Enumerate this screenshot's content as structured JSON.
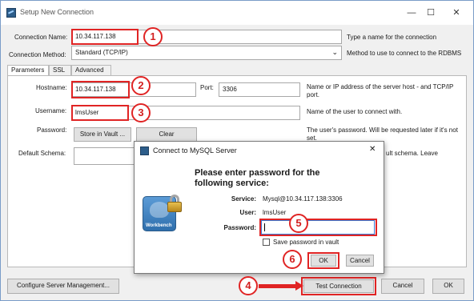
{
  "window": {
    "title": "Setup New Connection",
    "minimize": "—",
    "maximize": "☐",
    "close": "✕"
  },
  "form": {
    "connection_name": {
      "label": "Connection Name:",
      "value": "10.34.117.138",
      "help": "Type a name for the connection"
    },
    "connection_method": {
      "label": "Connection Method:",
      "value": "Standard (TCP/IP)",
      "help": "Method to use to connect to the RDBMS"
    }
  },
  "tabs": [
    {
      "label": "Parameters"
    },
    {
      "label": "SSL"
    },
    {
      "label": "Advanced"
    }
  ],
  "parameters": {
    "hostname": {
      "label": "Hostname:",
      "value": "10.34.117.138"
    },
    "port": {
      "label": "Port:",
      "value": "3306"
    },
    "host_help": "Name or IP address of the server host - and TCP/IP port.",
    "username": {
      "label": "Username:",
      "value": "lmsUser",
      "help": "Name of the user to connect with."
    },
    "password": {
      "label": "Password:",
      "store_button": "Store in Vault ...",
      "clear_button": "Clear",
      "help": "The user's password. Will be requested later if it's not set."
    },
    "default_schema": {
      "label": "Default Schema:",
      "value": "",
      "help_partial": "ult schema. Leave"
    }
  },
  "footer": {
    "configure_button": "Configure Server Management...",
    "test_button": "Test Connection",
    "cancel_button": "Cancel",
    "ok_button": "OK"
  },
  "dialog": {
    "title": "Connect to MySQL Server",
    "close": "✕",
    "heading": "Please enter password for the following service:",
    "service_label": "Service:",
    "service_value": "Mysql@10.34.117.138:3306",
    "user_label": "User:",
    "user_value": "lmsUser",
    "password_label": "Password:",
    "password_value": "",
    "save_checkbox_label": "Save password in vault",
    "save_checked": false,
    "ok_button": "OK",
    "cancel_button": "Cancel",
    "logo_text": "Workbench"
  },
  "annotations": {
    "step1": "1",
    "step2": "2",
    "step3": "3",
    "step4": "4",
    "step5": "5",
    "step6": "6",
    "color": "#e02424"
  }
}
